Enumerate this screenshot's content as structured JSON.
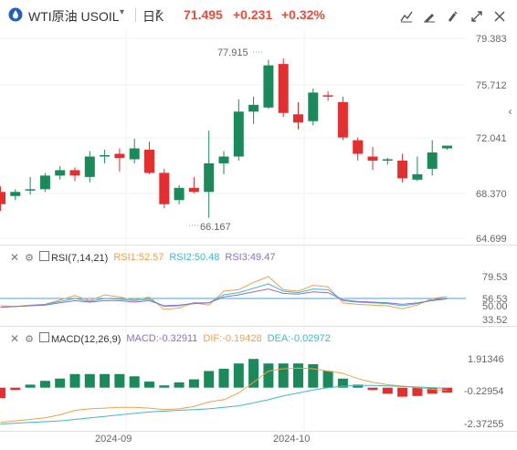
{
  "header": {
    "instrument": "WTI原油",
    "symbol": "USOIL",
    "period": "日K",
    "price": "71.495",
    "change": "+0.231",
    "change_pct": "+0.32%",
    "up_color": "#e62e2e",
    "down_color": "#1b8a5a"
  },
  "toolbar": {
    "icons": [
      "indicator-icon",
      "draw-icon",
      "edit-icon",
      "fullscreen-icon",
      "close-icon"
    ]
  },
  "main_chart": {
    "y_ticks": [
      "79.383",
      "75.712",
      "72.041",
      "68.370",
      "64.699"
    ],
    "high_label": "77.915",
    "low_label": "66.167"
  },
  "rsi": {
    "name": "RSI(7,14,21)",
    "rsi1": "RSI1:52.57",
    "rsi2": "RSI2:50.48",
    "rsi3": "RSI3:49.47",
    "y_ticks": [
      "79.53",
      "56.53",
      "50.00",
      "33.52"
    ],
    "colors": {
      "rsi1": "#f0a04b",
      "rsi2": "#3fb8c9",
      "rsi3": "#8b6fd1"
    }
  },
  "macd": {
    "name": "MACD(12,26,9)",
    "macd": "MACD:-0.32911",
    "dif": "DIF:-0.19428",
    "dea": "DEA:-0.02972",
    "y_ticks": [
      "1.91346",
      "-0.22954",
      "-2.37255"
    ],
    "colors": {
      "macd": "#8b6fd1",
      "dif": "#f0a04b",
      "dea": "#3fb8c9"
    }
  },
  "x_axis": {
    "labels": [
      "2024-09",
      "2024-10"
    ]
  },
  "chart_data": {
    "type": "candlestick",
    "candles": [
      {
        "o": 68.1,
        "h": 68.5,
        "l": 66.7,
        "c": 67.2
      },
      {
        "o": 67.8,
        "h": 68.3,
        "l": 67.5,
        "c": 68.1
      },
      {
        "o": 68.2,
        "h": 69.2,
        "l": 67.9,
        "c": 68.3
      },
      {
        "o": 68.3,
        "h": 69.5,
        "l": 68.1,
        "c": 69.3
      },
      {
        "o": 69.3,
        "h": 70.0,
        "l": 69.0,
        "c": 69.7
      },
      {
        "o": 69.7,
        "h": 69.9,
        "l": 68.9,
        "c": 69.3
      },
      {
        "o": 69.2,
        "h": 71.1,
        "l": 68.8,
        "c": 70.7
      },
      {
        "o": 70.8,
        "h": 71.2,
        "l": 70.2,
        "c": 70.8
      },
      {
        "o": 70.9,
        "h": 71.3,
        "l": 69.6,
        "c": 70.6
      },
      {
        "o": 70.5,
        "h": 72.0,
        "l": 70.2,
        "c": 71.3
      },
      {
        "o": 71.2,
        "h": 71.8,
        "l": 69.4,
        "c": 69.5
      },
      {
        "o": 69.5,
        "h": 69.8,
        "l": 66.9,
        "c": 67.2
      },
      {
        "o": 67.5,
        "h": 68.6,
        "l": 67.2,
        "c": 68.4
      },
      {
        "o": 68.4,
        "h": 69.2,
        "l": 68.0,
        "c": 68.1
      },
      {
        "o": 68.1,
        "h": 72.6,
        "l": 66.2,
        "c": 70.2
      },
      {
        "o": 70.2,
        "h": 71.1,
        "l": 69.4,
        "c": 70.7
      },
      {
        "o": 70.7,
        "h": 74.9,
        "l": 70.4,
        "c": 74.0
      },
      {
        "o": 74.0,
        "h": 75.1,
        "l": 73.1,
        "c": 74.5
      },
      {
        "o": 74.3,
        "h": 77.8,
        "l": 74.2,
        "c": 77.4
      },
      {
        "o": 77.5,
        "h": 77.9,
        "l": 73.6,
        "c": 73.9
      },
      {
        "o": 73.8,
        "h": 74.7,
        "l": 72.7,
        "c": 73.2
      },
      {
        "o": 73.3,
        "h": 75.7,
        "l": 73.0,
        "c": 75.4
      },
      {
        "o": 75.2,
        "h": 75.5,
        "l": 74.8,
        "c": 75.1
      },
      {
        "o": 74.7,
        "h": 75.1,
        "l": 71.9,
        "c": 72.1
      },
      {
        "o": 71.9,
        "h": 72.1,
        "l": 70.4,
        "c": 70.9
      },
      {
        "o": 70.7,
        "h": 71.4,
        "l": 69.7,
        "c": 70.4
      },
      {
        "o": 70.4,
        "h": 70.6,
        "l": 70.1,
        "c": 70.5
      },
      {
        "o": 70.4,
        "h": 70.9,
        "l": 68.8,
        "c": 69.1
      },
      {
        "o": 69.0,
        "h": 70.7,
        "l": 68.9,
        "c": 69.4
      },
      {
        "o": 69.8,
        "h": 71.9,
        "l": 69.3,
        "c": 71.0
      },
      {
        "o": 71.3,
        "h": 71.5,
        "l": 71.2,
        "c": 71.5
      }
    ],
    "rsi1": [
      40,
      39,
      41,
      42,
      48,
      54,
      47,
      55,
      52,
      48,
      52,
      35,
      37,
      44,
      41,
      60,
      62,
      72,
      80,
      62,
      60,
      68,
      66,
      44,
      42,
      41,
      40,
      36,
      41,
      50,
      52.57
    ],
    "rsi2": [
      38,
      39,
      40,
      42,
      46,
      50,
      46,
      50,
      49,
      47,
      49,
      39,
      40,
      44,
      44,
      55,
      58,
      64,
      70,
      60,
      58,
      63,
      62,
      47,
      45,
      44,
      43,
      40,
      43,
      48,
      50.48
    ],
    "rsi3": [
      38,
      39,
      40,
      41,
      44,
      47,
      45,
      47,
      47,
      45,
      47,
      40,
      41,
      43,
      44,
      52,
      55,
      59,
      63,
      57,
      56,
      59,
      58,
      48,
      46,
      45,
      44,
      42,
      44,
      47,
      49.47
    ],
    "macd_hist": [
      -0.7,
      -0.15,
      0.2,
      0.45,
      0.6,
      0.9,
      0.9,
      0.9,
      0.9,
      0.75,
      0.4,
      0.15,
      0.35,
      0.55,
      1.1,
      1.25,
      1.6,
      1.9,
      1.6,
      1.6,
      1.6,
      1.55,
      1.1,
      0.6,
      0.2,
      -0.15,
      -0.4,
      -0.6,
      -0.55,
      -0.4,
      -0.33
    ],
    "dif": [
      -2.3,
      -2.2,
      -2.1,
      -2.0,
      -1.8,
      -1.5,
      -1.4,
      -1.35,
      -1.3,
      -1.3,
      -1.35,
      -1.45,
      -1.4,
      -1.25,
      -0.95,
      -0.8,
      -0.35,
      0.35,
      1.1,
      1.25,
      1.3,
      1.25,
      1.1,
      0.95,
      0.6,
      0.35,
      0.2,
      0.1,
      0.0,
      -0.1,
      -0.19
    ],
    "dea": [
      -2.4,
      -2.35,
      -2.3,
      -2.25,
      -2.2,
      -2.1,
      -2.0,
      -1.9,
      -1.8,
      -1.7,
      -1.6,
      -1.55,
      -1.5,
      -1.45,
      -1.4,
      -1.3,
      -1.2,
      -1.0,
      -0.8,
      -0.55,
      -0.35,
      -0.15,
      0.0,
      0.1,
      0.15,
      0.15,
      0.12,
      0.08,
      0.05,
      0.0,
      -0.03
    ]
  }
}
